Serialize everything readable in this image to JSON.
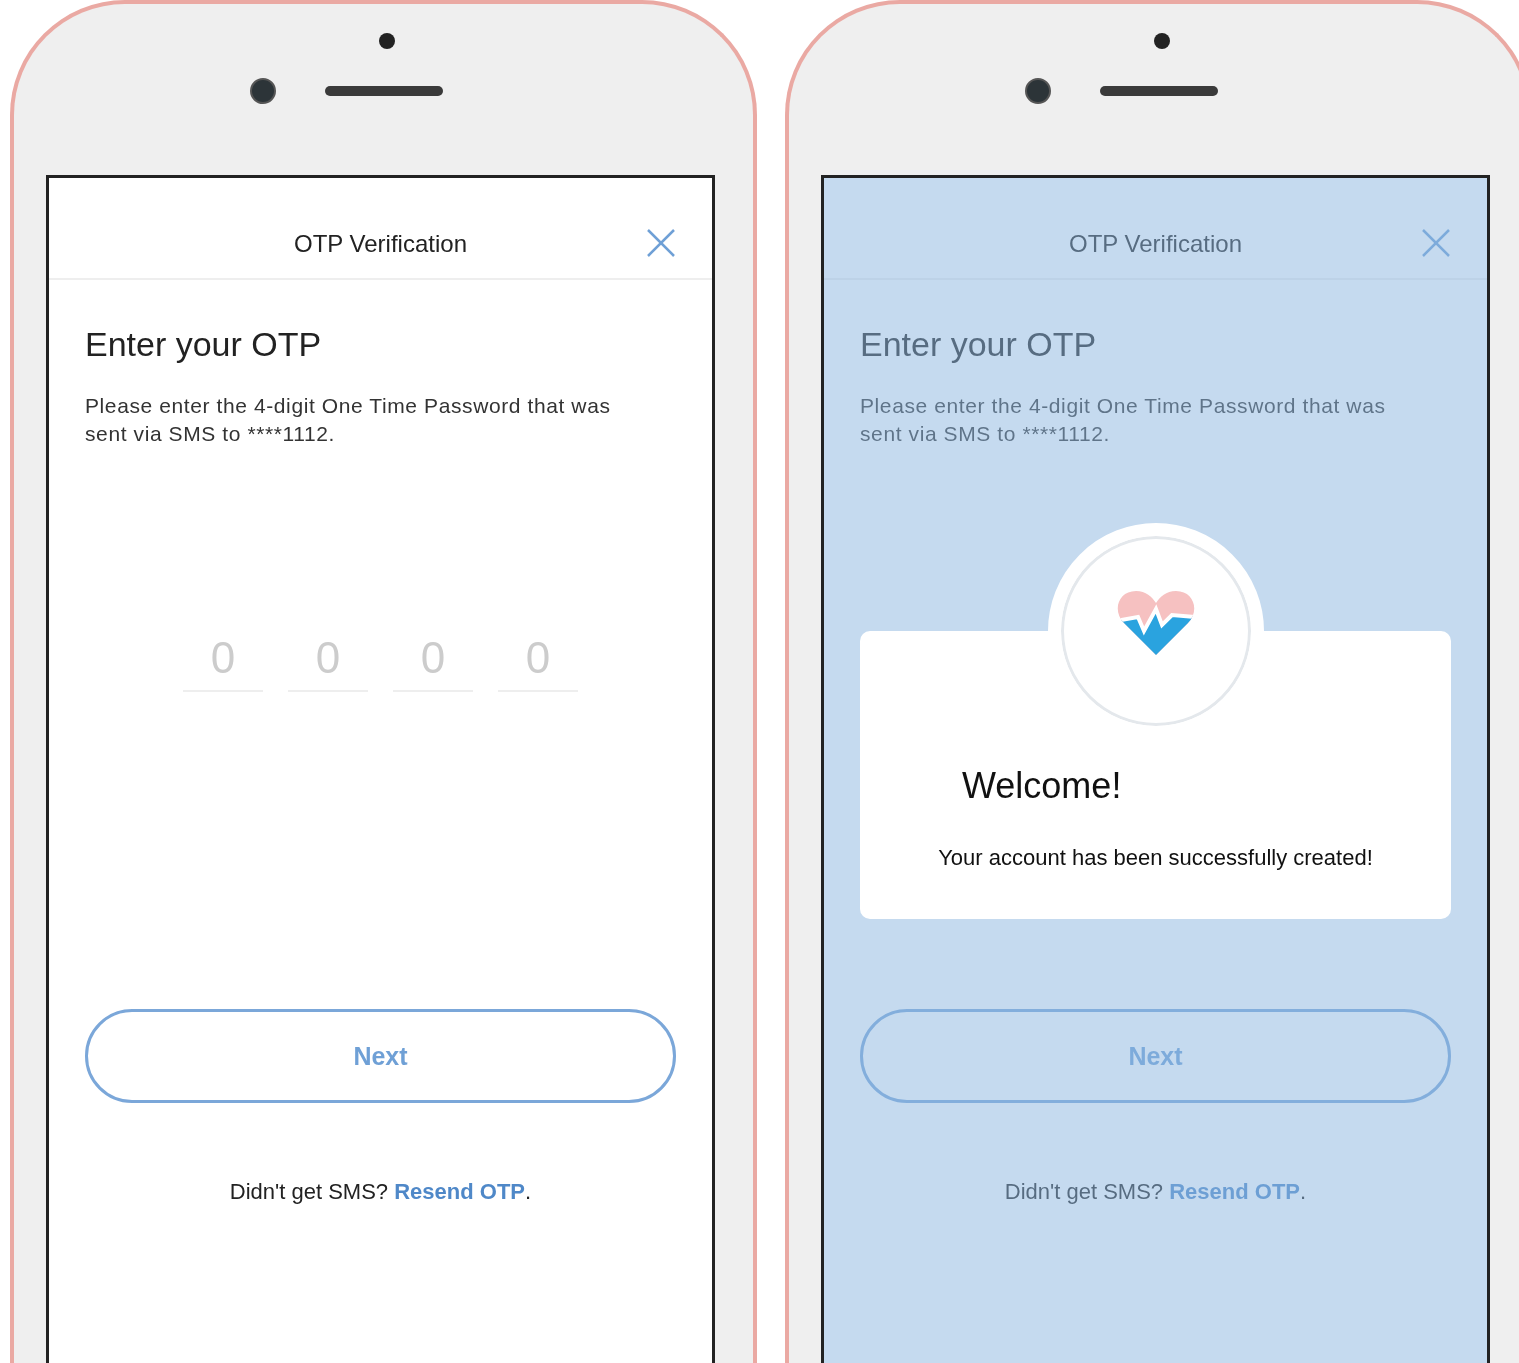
{
  "phones": [
    {
      "header_title": "OTP Verification",
      "heading": "Enter your OTP",
      "instructions": "Please enter the 4-digit One Time Password that was sent via SMS to ****1112.",
      "otp_digits": [
        {
          "placeholder": "0"
        },
        {
          "placeholder": "0"
        },
        {
          "placeholder": "0"
        },
        {
          "placeholder": "0"
        }
      ],
      "next_button": "Next",
      "resend_prompt": "Didn't get SMS?",
      "resend_link": "Resend OTP",
      "resend_end": "."
    },
    {
      "header_title": "OTP Verification",
      "heading": "Enter your OTP",
      "instructions": "Please enter the 4-digit One Time Password that was sent via SMS to ****1112.",
      "next_button": "Next",
      "resend_prompt": "Didn't get SMS?",
      "resend_link": "Resend OTP",
      "resend_end": ".",
      "modal": {
        "title": "Welcome!",
        "message": "Your account has been successfully created!"
      }
    }
  ]
}
